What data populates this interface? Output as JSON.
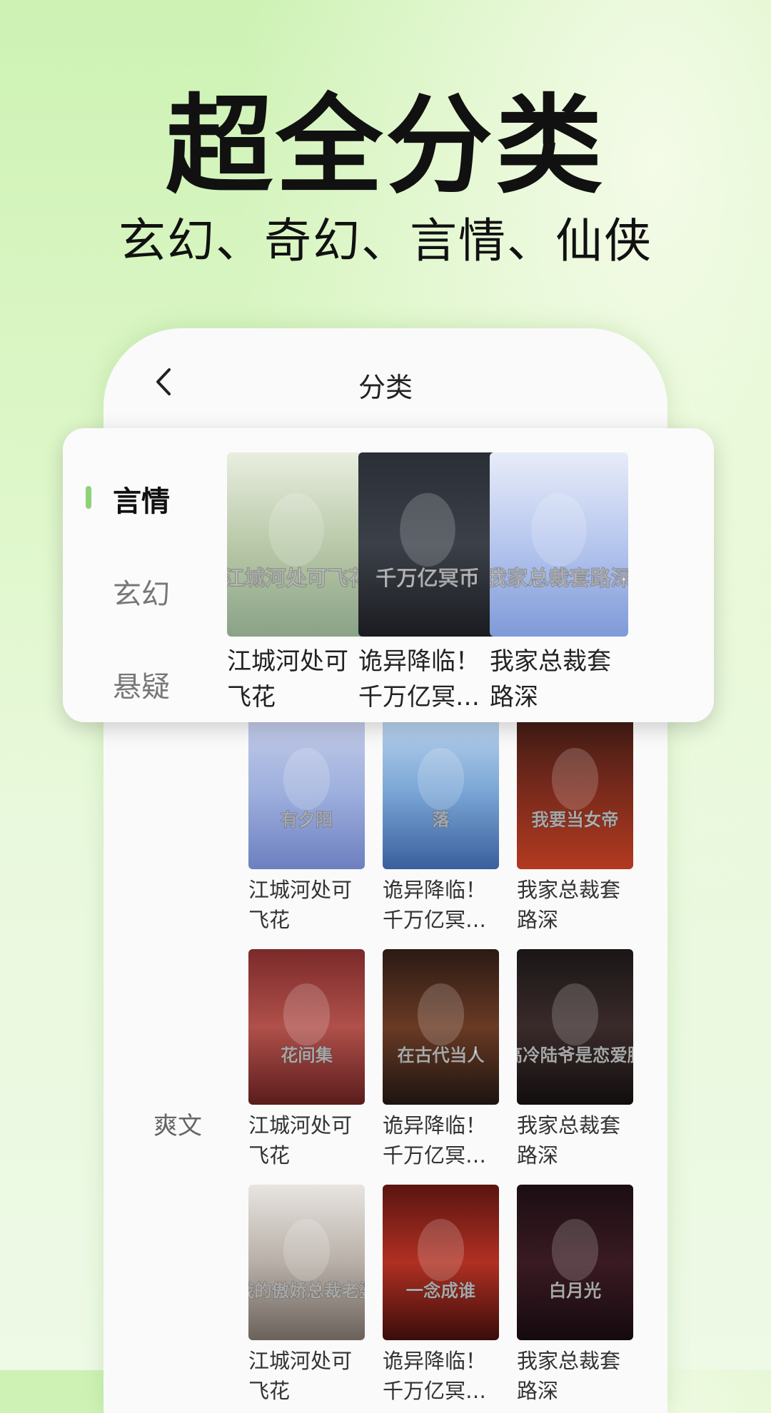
{
  "headline": "超全分类",
  "subheadline": "玄幻、奇幻、言情、仙侠",
  "screen": {
    "title": "分类",
    "back_icon": "chevron-left-icon"
  },
  "popup_categories": [
    {
      "label": "言情",
      "active": true
    },
    {
      "label": "玄幻",
      "active": false
    },
    {
      "label": "悬疑",
      "active": false
    }
  ],
  "popup_books": [
    {
      "title": "江城河处可\n飞花",
      "cover_text": "江城河处可飞花"
    },
    {
      "title": "诡异降临！\n千万亿冥…",
      "cover_text": "千万亿冥币"
    },
    {
      "title": "我家总裁套\n路深",
      "cover_text": "我家总裁套路深"
    }
  ],
  "background_categories": [
    {
      "label": "爽文"
    }
  ],
  "grid_books": [
    {
      "title": "江城河处可\n飞花",
      "cover_text": "有夕阳"
    },
    {
      "title": "诡异降临！\n千万亿冥…",
      "cover_text": "落"
    },
    {
      "title": "我家总裁套\n路深",
      "cover_text": "我要当女帝"
    },
    {
      "title": "江城河处可\n飞花",
      "cover_text": "花间集"
    },
    {
      "title": "诡异降临！\n千万亿冥…",
      "cover_text": "在古代当人"
    },
    {
      "title": "我家总裁套\n路深",
      "cover_text": "高冷陆爷是恋爱脑"
    },
    {
      "title": "江城河处可\n飞花",
      "cover_text": "我的傲娇总裁老婆"
    },
    {
      "title": "诡异降临！\n千万亿冥…",
      "cover_text": "一念成谁"
    },
    {
      "title": "我家总裁套\n路深",
      "cover_text": "白月光"
    }
  ],
  "colors": {
    "accent": "#8dd276",
    "background_top": "#cdf2b4",
    "background_bottom": "#eef9e6"
  }
}
